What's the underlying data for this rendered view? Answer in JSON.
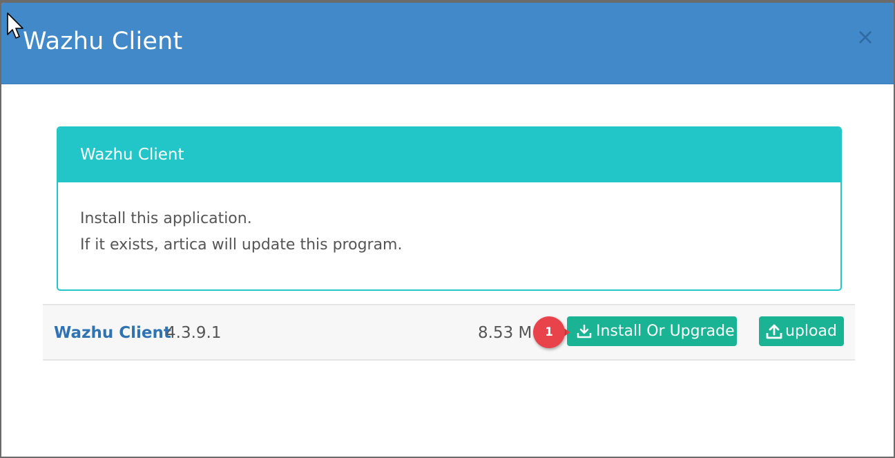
{
  "modal": {
    "title": "Wazhu Client",
    "close_symbol": "×"
  },
  "panel": {
    "title": "Wazhu Client",
    "line1": "Install this application.",
    "line2": "If it exists, artica will update this program."
  },
  "app_row": {
    "name": "Wazhu Client",
    "version": "4.3.9.1",
    "size": "8.53 M",
    "install_label": "Install Or Upgrade",
    "upload_label": "upload",
    "install_icon": "download-icon",
    "upload_icon": "upload-icon"
  },
  "annotation": {
    "step_number": "1",
    "color": "#e8434a"
  },
  "colors": {
    "header": "#4289c9",
    "panel_accent": "#23c6c8",
    "button": "#1ab394",
    "link": "#2f73b3"
  }
}
